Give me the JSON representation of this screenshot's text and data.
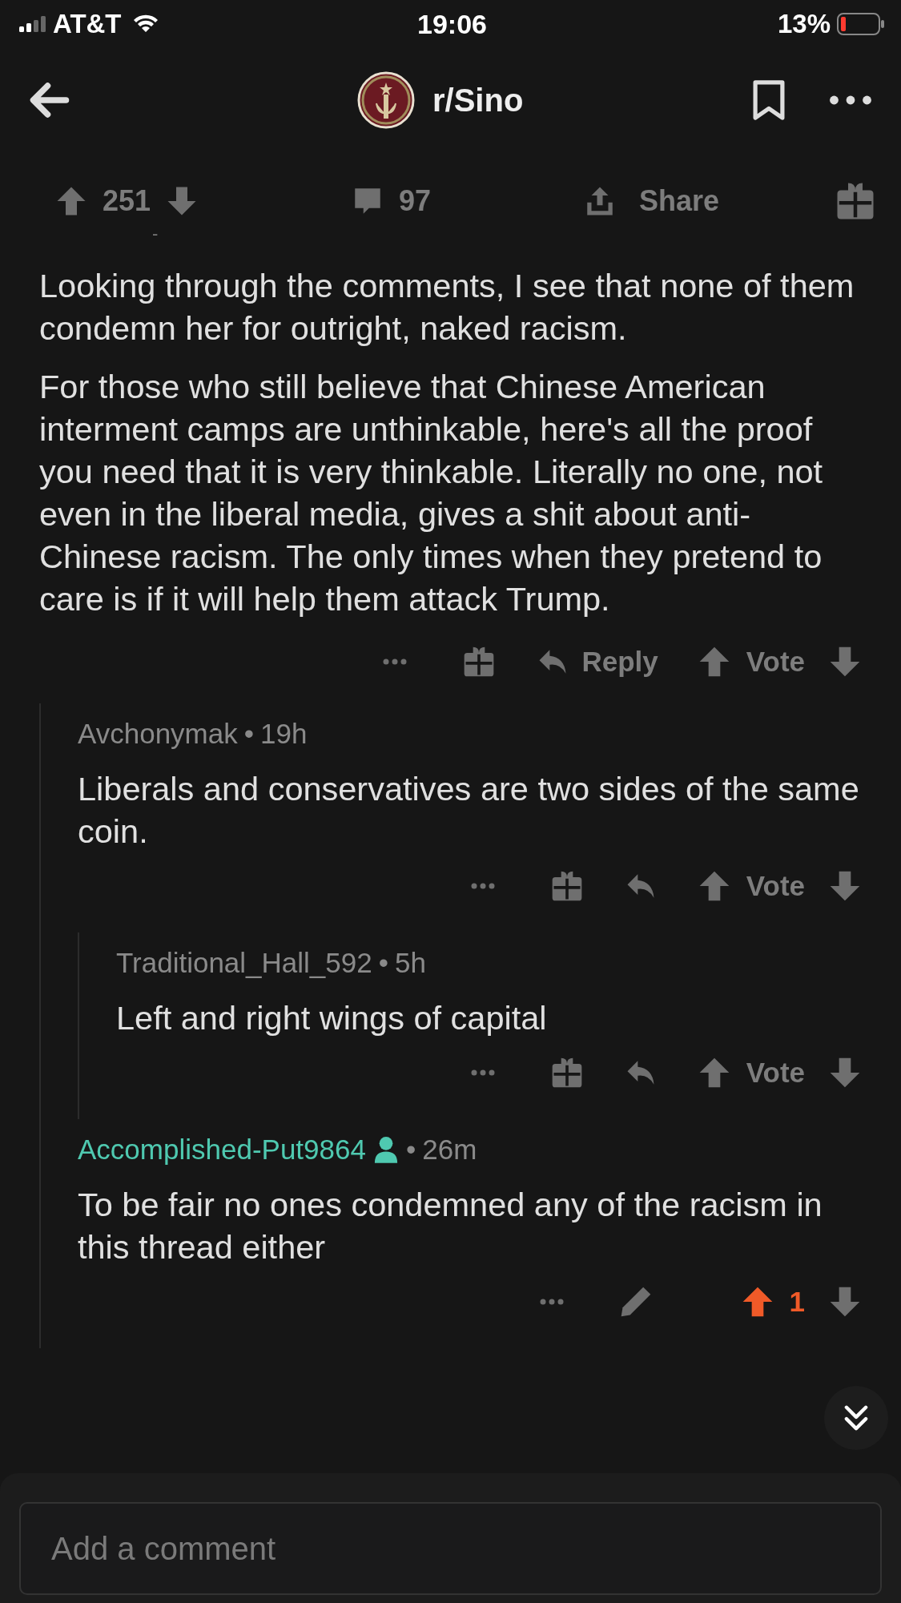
{
  "status_bar": {
    "carrier": "AT&T",
    "time": "19:06",
    "battery": "13%"
  },
  "header": {
    "title": "r/Sino"
  },
  "post_bar": {
    "score": "251",
    "comments": "97",
    "share": "Share"
  },
  "collapsed_marker": "-",
  "comment": {
    "paragraphs": [
      "Looking through the comments, I see that none of them condemn her for outright, naked racism.",
      "For those who still believe that Chinese American interment camps are unthinkable, here's all the proof you need that it is very thinkable. Literally no one, not even in the liberal media, gives a shit about anti-Chinese racism. The only times when they pretend to care is if it will help them attack Trump."
    ],
    "reply_label": "Reply",
    "vote_label": "Vote",
    "children": [
      {
        "kind": "other",
        "author": "Avchonymak",
        "separator": "•",
        "age": "19h",
        "body": "Liberals and conservatives are two sides of the same coin.",
        "vote_label": "Vote",
        "upvoted": false,
        "children": [
          {
            "kind": "other",
            "author": "Traditional_Hall_592",
            "separator": "•",
            "age": "5h",
            "body": "Left and right wings of capital",
            "vote_label": "Vote",
            "upvoted": false
          }
        ]
      },
      {
        "kind": "own",
        "author": "Accomplished-Put9864",
        "separator": "•",
        "age": "26m",
        "body": "To be fair no ones condemned any of the racism in this thread either",
        "score": "1",
        "upvoted": true
      }
    ]
  },
  "composer": {
    "placeholder": "Add a comment"
  }
}
